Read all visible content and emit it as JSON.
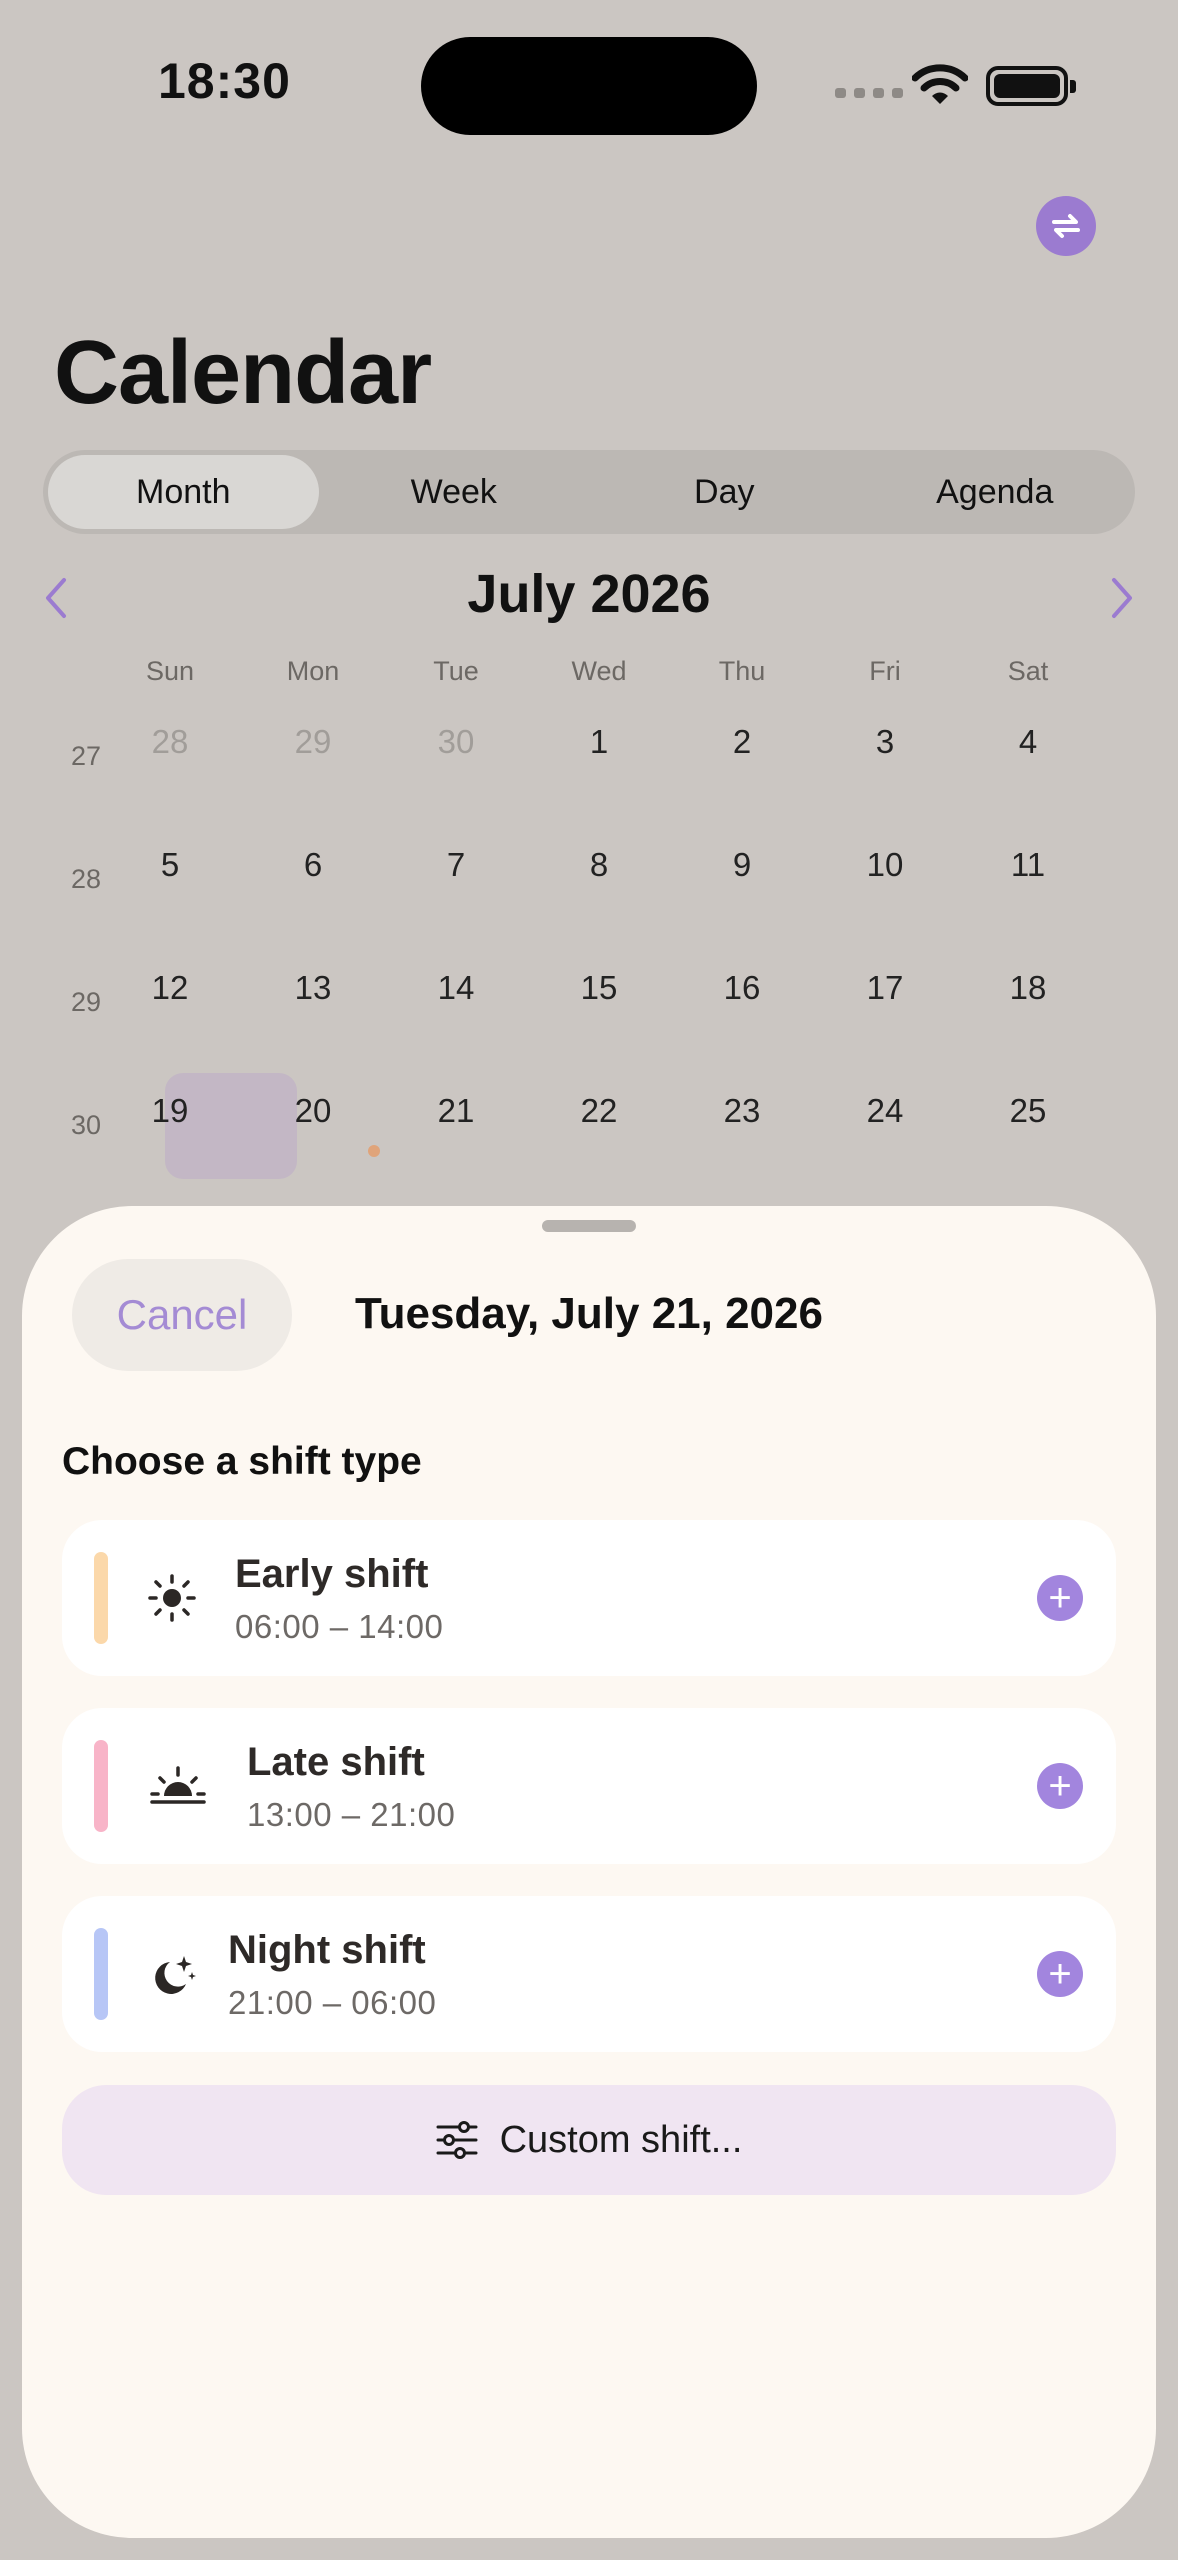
{
  "status_bar": {
    "time": "18:30"
  },
  "header": {
    "title": "Calendar"
  },
  "view_tabs": [
    "Month",
    "Week",
    "Day",
    "Agenda"
  ],
  "selected_tab": "Month",
  "calendar": {
    "month_label": "July 2026",
    "weekdays": [
      "Sun",
      "Mon",
      "Tue",
      "Wed",
      "Thu",
      "Fri",
      "Sat"
    ],
    "weeks": [
      {
        "number": "27",
        "days": [
          "28",
          "29",
          "30",
          "1",
          "2",
          "3",
          "4"
        ],
        "dim": [
          true,
          true,
          true,
          false,
          false,
          false,
          false
        ]
      },
      {
        "number": "28",
        "days": [
          "5",
          "6",
          "7",
          "8",
          "9",
          "10",
          "11"
        ],
        "dim": [
          false,
          false,
          false,
          false,
          false,
          false,
          false
        ]
      },
      {
        "number": "29",
        "days": [
          "12",
          "13",
          "14",
          "15",
          "16",
          "17",
          "18"
        ],
        "dim": [
          false,
          false,
          false,
          false,
          false,
          false,
          false
        ]
      },
      {
        "number": "30",
        "days": [
          "19",
          "20",
          "21",
          "22",
          "23",
          "24",
          "25"
        ],
        "dim": [
          false,
          false,
          false,
          false,
          false,
          false,
          false
        ]
      }
    ],
    "today": "19",
    "event_dot_day": "20",
    "event_dot_color": "#e0a47a"
  },
  "sheet": {
    "cancel_label": "Cancel",
    "date_label": "Tuesday, July 21, 2026",
    "section_title": "Choose a shift type",
    "shifts": [
      {
        "name": "Early shift",
        "time": "06:00 – 14:00",
        "color": "#fbd8aa",
        "icon": "sun-icon"
      },
      {
        "name": "Late shift",
        "time": "13:00 – 21:00",
        "color": "#f8b4c8",
        "icon": "sunset-icon"
      },
      {
        "name": "Night shift",
        "time": "21:00 – 06:00",
        "color": "#b7c6f6",
        "icon": "moon-stars-icon"
      }
    ],
    "custom_label": "Custom shift...",
    "custom_icon": "sliders-icon"
  },
  "accent_color": "#9b7bd0"
}
